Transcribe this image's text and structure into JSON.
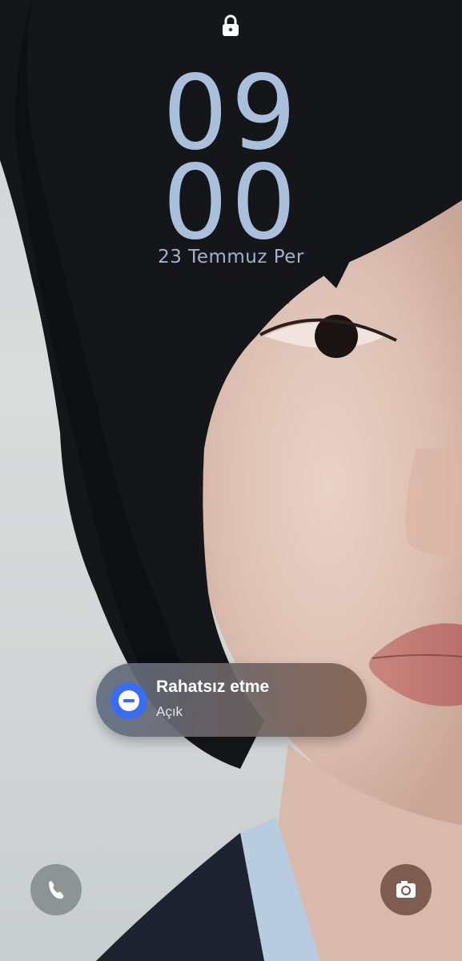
{
  "lock_screen": {
    "clock": {
      "hours": "09",
      "minutes": "00"
    },
    "date": "23 Temmuz Per",
    "lock_icon": "lock-icon"
  },
  "dnd_notification": {
    "title": "Rahatsız etme",
    "status": "Açık",
    "icon": "do-not-disturb-icon",
    "accent_color": "#3a6df0"
  },
  "shortcuts": {
    "left": {
      "icon": "phone-icon"
    },
    "right": {
      "icon": "camera-icon"
    }
  },
  "colors": {
    "clock": "#a9bfdc",
    "date": "#9fb3cf"
  }
}
